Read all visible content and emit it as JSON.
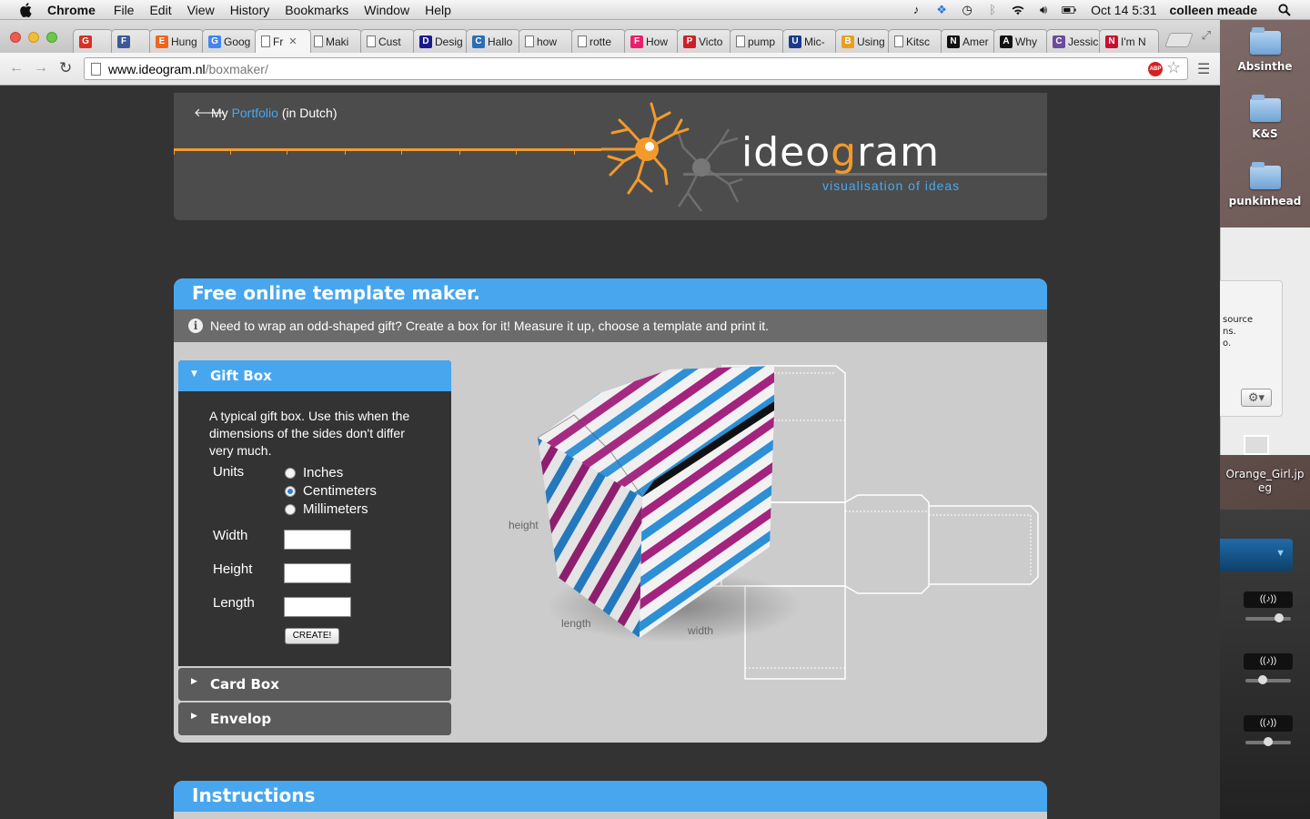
{
  "menubar": {
    "app_name": "Chrome",
    "items": [
      "File",
      "Edit",
      "View",
      "History",
      "Bookmarks",
      "Window",
      "Help"
    ],
    "clock": "Oct 14  5:31",
    "user": "colleen meade"
  },
  "desktop": {
    "icons": [
      "Absinthe",
      "K&S",
      "punkinhead"
    ],
    "panel_text": [
      "source",
      "ns.",
      "o."
    ],
    "file_label": "Orange_Girl.jp eg"
  },
  "tabs": [
    {
      "label": "",
      "icon": "gmail-icon",
      "color": "#d93025"
    },
    {
      "label": "",
      "icon": "facebook-icon",
      "color": "#3b5998"
    },
    {
      "label": "Hung",
      "icon": "etsy-icon",
      "color": "#f1641e"
    },
    {
      "label": "Goog",
      "icon": "google-doc-icon",
      "color": "#4285f4"
    },
    {
      "label": "Fr",
      "icon": "page-icon",
      "color": "#ffffff",
      "active": true
    },
    {
      "label": "Maki",
      "icon": "page-icon",
      "color": "#ffffff"
    },
    {
      "label": "Cust",
      "icon": "page-icon",
      "color": "#ffffff"
    },
    {
      "label": "Desig",
      "icon": "d-icon",
      "color": "#1a1a8c"
    },
    {
      "label": "Hallo",
      "icon": "cl-icon",
      "color": "#2a6fb5"
    },
    {
      "label": "how",
      "icon": "page-icon",
      "color": "#ffffff"
    },
    {
      "label": "rotte",
      "icon": "page-icon",
      "color": "#ffffff"
    },
    {
      "label": "How",
      "icon": "flickr-icon",
      "color": "#e8206b"
    },
    {
      "label": "Victo",
      "icon": "pinterest-icon",
      "color": "#cb2027"
    },
    {
      "label": "pump",
      "icon": "page-icon",
      "color": "#ffffff"
    },
    {
      "label": "Mic-",
      "icon": "uk-icon",
      "color": "#1a3a8c"
    },
    {
      "label": "Using",
      "icon": "bear-icon",
      "color": "#e8a020"
    },
    {
      "label": "Kitsc",
      "icon": "page-icon",
      "color": "#ffffff"
    },
    {
      "label": "Amer",
      "icon": "nyt-icon",
      "color": "#111111"
    },
    {
      "label": "Why",
      "icon": "amazon-icon",
      "color": "#111111"
    },
    {
      "label": "Jessic",
      "icon": "circle-icon",
      "color": "#6a4c9c"
    },
    {
      "label": "I'm N",
      "icon": "n-icon",
      "color": "#c8102e"
    }
  ],
  "address": {
    "domain": "www.ideogram.nl",
    "path": "/boxmaker/"
  },
  "header": {
    "back_prefix": "My",
    "portfolio_link": "Portfolio",
    "back_suffix": "(in Dutch)",
    "logo_pre": "ideo",
    "logo_g": "g",
    "logo_post": "ram",
    "tagline": "visualisation of ideas"
  },
  "maker": {
    "title": "Free online template maker.",
    "info": "Need to wrap an odd-shaped gift? Create a box for it! Measure it up, choose a template and print it.",
    "giftbox": {
      "title": "Gift Box",
      "description": "A typical gift box. Use this when the dimensions of the sides don't differ very much.",
      "units_label": "Units",
      "units": [
        {
          "label": "Inches",
          "checked": false
        },
        {
          "label": "Centimeters",
          "checked": true
        },
        {
          "label": "Millimeters",
          "checked": false
        }
      ],
      "width_label": "Width",
      "height_label": "Height",
      "length_label": "Length",
      "width_value": "",
      "height_value": "",
      "length_value": "",
      "create_label": "CREATE!"
    },
    "cardbox_title": "Card Box",
    "envelop_title": "Envelop",
    "preview": {
      "height_label": "height",
      "length_label": "length",
      "width_label": "width"
    }
  },
  "instructions": {
    "title": "Instructions"
  },
  "colors": {
    "accent_blue": "#47a6ee",
    "logo_orange": "#f39a2b",
    "stripe_magenta": "#a3237e",
    "stripe_blue": "#2d8fd6"
  }
}
